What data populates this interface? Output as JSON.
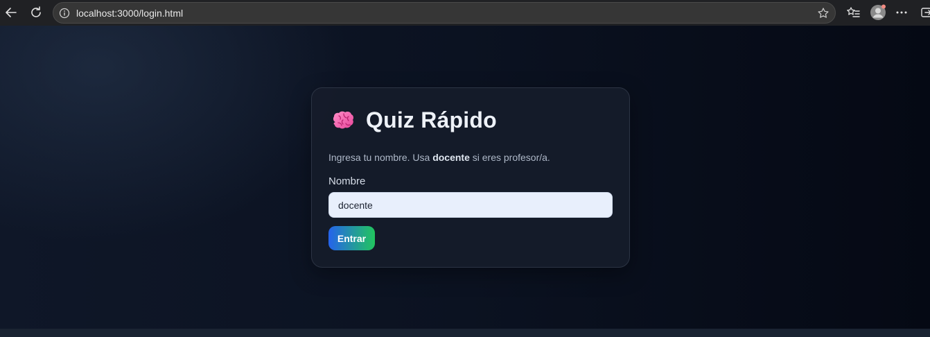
{
  "browser": {
    "url": "localhost:3000/login.html",
    "icons": [
      "back-arrow-icon",
      "reload-icon",
      "info-icon",
      "star-icon",
      "favorites-icon",
      "profile-avatar-icon",
      "more-icon",
      "extension-icon"
    ]
  },
  "login": {
    "title": "Quiz Rápido",
    "title_icon": "brain-icon",
    "desc_prefix": "Ingresa tu nombre. Usa ",
    "desc_bold": "docente",
    "desc_suffix": " si eres profesor/a.",
    "field_label": "Nombre",
    "field_value": "docente",
    "submit_label": "Entrar"
  },
  "colors": {
    "background": "#0b1220",
    "card": "#161c2a",
    "input_bg": "#e8effc",
    "button_gradient_start": "#2563eb",
    "button_gradient_end": "#22c55e"
  }
}
